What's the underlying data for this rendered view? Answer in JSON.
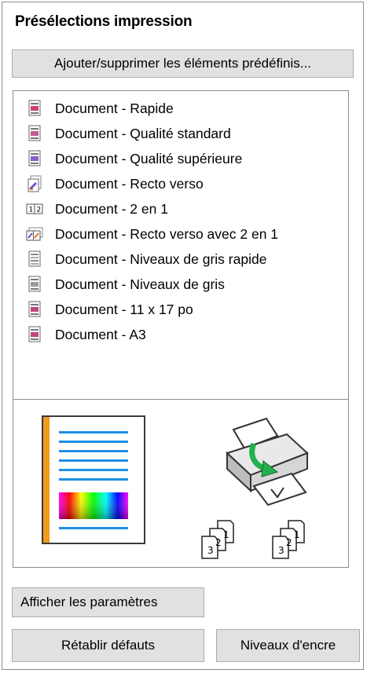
{
  "panel": {
    "title": "Présélections impression",
    "add_remove_button": "Ajouter/supprimer les éléments prédéfinis...",
    "presets": [
      {
        "label": "Document - Rapide",
        "icon": "doc-fast-icon"
      },
      {
        "label": "Document - Qualité standard",
        "icon": "doc-standard-icon"
      },
      {
        "label": "Document - Qualité supérieure",
        "icon": "doc-high-quality-icon"
      },
      {
        "label": "Document - Recto verso",
        "icon": "doc-duplex-icon"
      },
      {
        "label": "Document - 2 en 1",
        "icon": "two-up-icon"
      },
      {
        "label": "Document - Recto verso avec 2 en 1",
        "icon": "duplex-two-up-icon"
      },
      {
        "label": "Document - Niveaux de gris rapide",
        "icon": "grayscale-fast-icon"
      },
      {
        "label": "Document - Niveaux de gris",
        "icon": "grayscale-icon"
      },
      {
        "label": "Document - 11 x 17 po",
        "icon": "doc-11x17-icon"
      },
      {
        "label": "Document - A3",
        "icon": "doc-a3-icon"
      }
    ],
    "preview": {
      "collate_numbers_left": [
        "3",
        "2",
        "1"
      ],
      "collate_numbers_right": [
        "3",
        "2",
        "1"
      ]
    },
    "show_settings_button": "Afficher les paramètres",
    "reset_defaults_button": "Rétablir défauts",
    "ink_levels_button": "Niveaux d'encre"
  },
  "colors": {
    "button_bg": "#e1e1e1",
    "border": "#8c8c8c",
    "preview_lines": "#1e8fe6",
    "preview_margin": "#f29a1a",
    "arrow_green": "#22b14c"
  }
}
